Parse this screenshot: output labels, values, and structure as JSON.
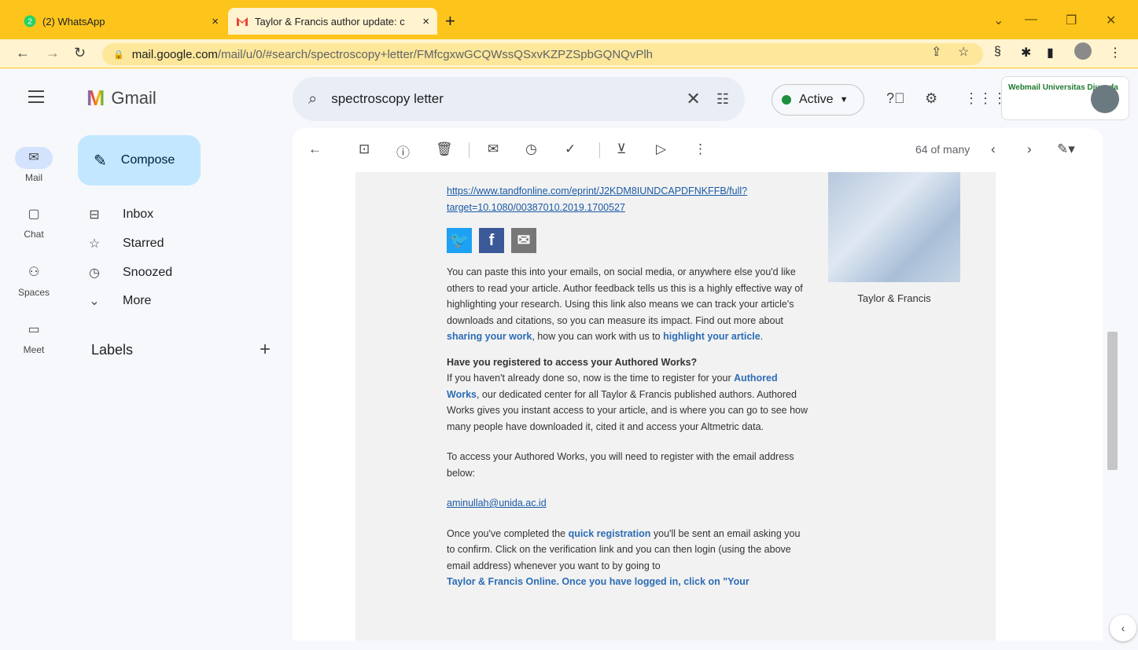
{
  "browser": {
    "tabs": [
      {
        "title": "(2) WhatsApp",
        "badge": "2",
        "close": "×"
      },
      {
        "title": "Taylor & Francis author update: c",
        "close": "×"
      }
    ],
    "new_tab": "+",
    "url_host": "mail.google.com",
    "url_path": "/mail/u/0/#search/spectroscopy+letter/FMfcgxwGCQWssQSxvKZPZSpbGQNQvPlh"
  },
  "gmail": {
    "app_name": "Gmail",
    "search_value": "spectroscopy letter",
    "status": "Active",
    "account_logo_text": "Webmail Universitas Djuanda",
    "rail": [
      {
        "label": "Mail",
        "icon": "mail-icon"
      },
      {
        "label": "Chat",
        "icon": "chat-icon"
      },
      {
        "label": "Spaces",
        "icon": "spaces-icon"
      },
      {
        "label": "Meet",
        "icon": "meet-icon"
      }
    ],
    "compose": "Compose",
    "nav": [
      {
        "label": "Inbox",
        "icon": "inbox-icon"
      },
      {
        "label": "Starred",
        "icon": "star-icon"
      },
      {
        "label": "Snoozed",
        "icon": "clock-icon"
      },
      {
        "label": "More",
        "icon": "chevron-down-icon"
      }
    ],
    "labels_heading": "Labels",
    "pager": "64 of many"
  },
  "email": {
    "link1": "https://www.tandfonline.com/eprint/J2KDM8IUNDCAPDFNKFFB/full?",
    "link2": "target=10.1080/00387010.2019.1700527",
    "para1_pre": "You can paste this into your emails, on social media, or anywhere else you'd like others to read your article. Author feedback tells us this is a highly effective way of highlighting your research. Using this link also means we can track your article's downloads and citations, so you can measure its impact. Find out more about ",
    "para1_link1": "sharing your work",
    "para1_mid": ", how you can work with us to ",
    "para1_link2": "highlight your article",
    "para1_end": ".",
    "heading2": "Have you registered to access your Authored Works?",
    "para2_pre": "If you haven't already done so, now is the time to register for your ",
    "para2_link": "Authored Works",
    "para2_post": ", our dedicated center for all Taylor & Francis published authors. Authored Works gives you instant access to your article, and is where you can go to see how many people have downloaded it, cited it and access your Altmetric data.",
    "para3": "To access your Authored Works, you will need to register with the email address below:",
    "email_addr": "aminullah@unida.ac.id",
    "para4_pre": "Once you've completed the ",
    "para4_link": "quick registration",
    "para4_post": " you'll be sent an email asking you to confirm. Click on the verification link and you can then login (using the above email address) whenever you want to by going to",
    "para4_cut": "Taylor & Francis Online. Once you have logged in, click on \"Your",
    "cover_caption": "Taylor & Francis"
  }
}
